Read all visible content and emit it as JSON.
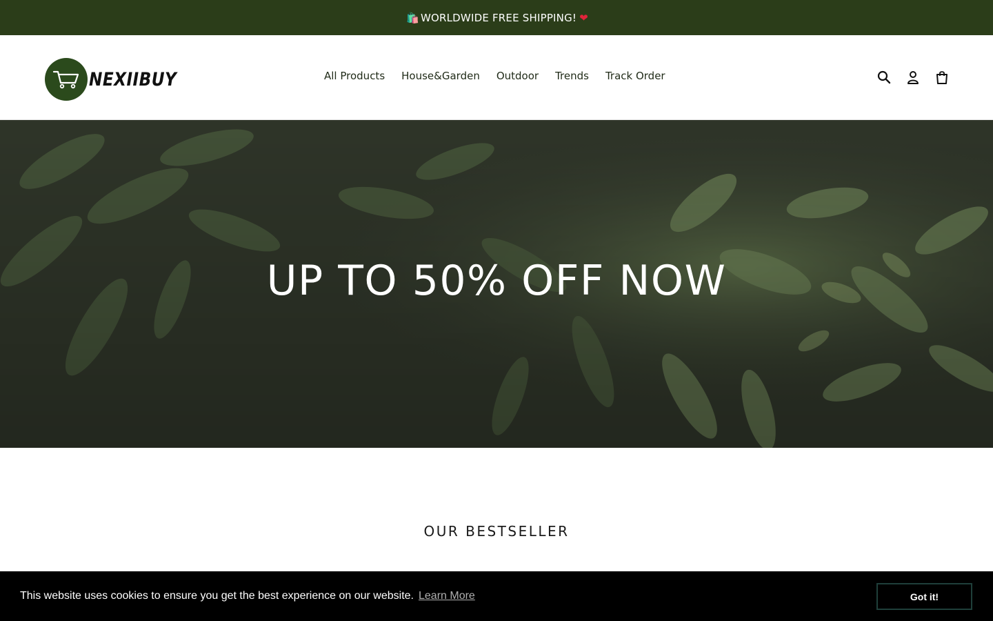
{
  "announcement": {
    "text": "WORLDWIDE FREE SHIPPING!",
    "leading_icon": "shopping-bags-emoji",
    "trailing_icon": "red-heart-emoji"
  },
  "header": {
    "logo_text": "NEXIIBUY",
    "nav": [
      {
        "label": "All Products"
      },
      {
        "label": "House&Garden"
      },
      {
        "label": "Outdoor"
      },
      {
        "label": "Trends"
      },
      {
        "label": "Track Order"
      }
    ],
    "icons": [
      "search-icon",
      "account-icon",
      "cart-icon"
    ]
  },
  "hero": {
    "title": "UP TO 50% OFF NOW"
  },
  "section": {
    "title": "OUR BESTSELLER"
  },
  "cookie": {
    "message": "This website uses cookies to ensure you get the best experience on our website.",
    "link_label": "Learn More",
    "button_label": "Got it!"
  },
  "colors": {
    "announcement_bg": "#2b3d19",
    "logo_circle": "#2b4a1c",
    "cookie_bg": "#000000",
    "cookie_button_border": "#1f3f3a"
  }
}
